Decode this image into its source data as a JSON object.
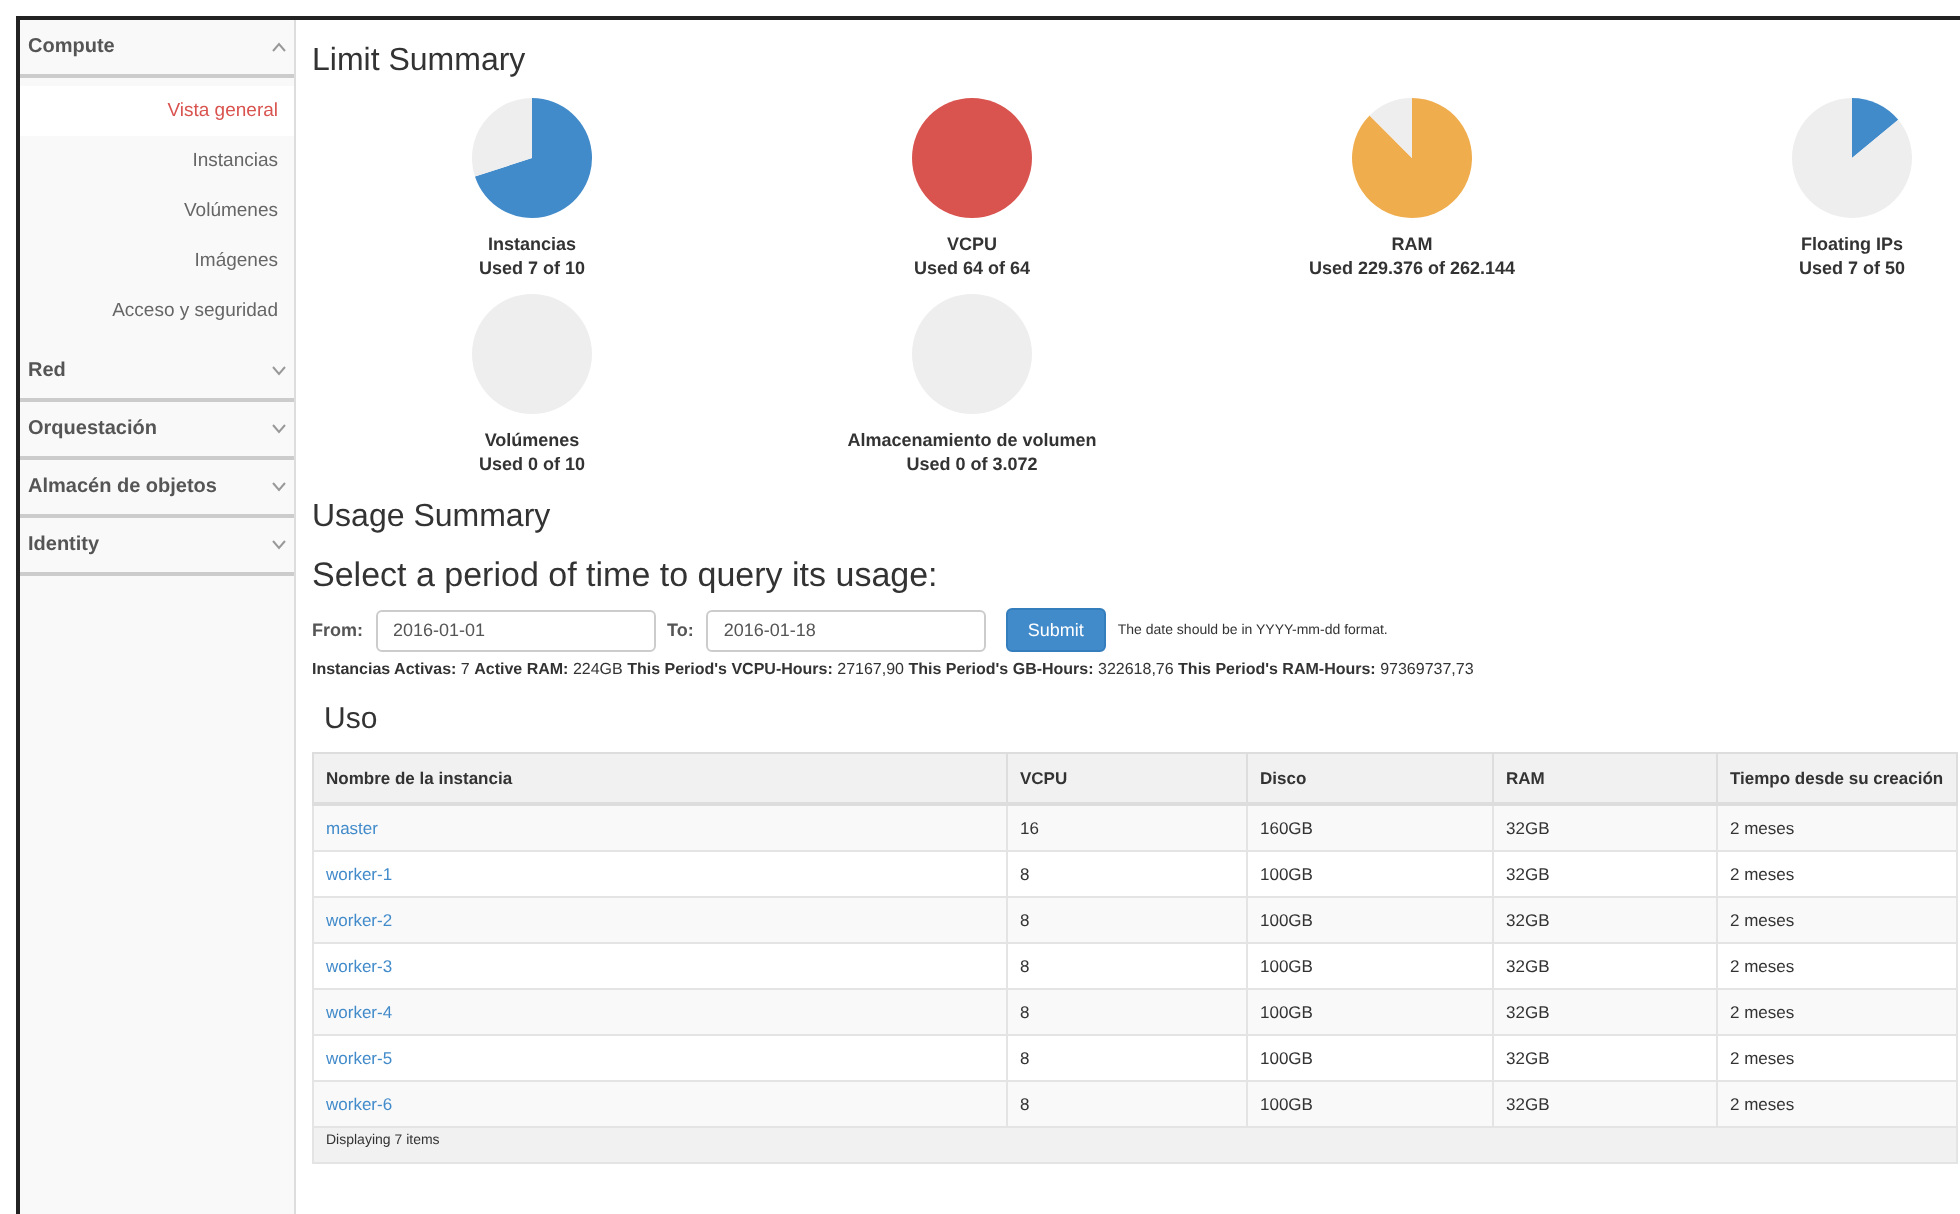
{
  "sidebar": {
    "sections": [
      {
        "label": "Compute",
        "expanded": true,
        "items": [
          {
            "label": "Vista general",
            "selected": true
          },
          {
            "label": "Instancias",
            "selected": false
          },
          {
            "label": "Volúmenes",
            "selected": false
          },
          {
            "label": "Imágenes",
            "selected": false
          },
          {
            "label": "Acceso y seguridad",
            "selected": false
          }
        ]
      },
      {
        "label": "Red",
        "expanded": false
      },
      {
        "label": "Orquestación",
        "expanded": false
      },
      {
        "label": "Almacén de objetos",
        "expanded": false
      },
      {
        "label": "Identity",
        "expanded": false
      }
    ]
  },
  "limit_summary": {
    "title": "Limit Summary",
    "meters": [
      {
        "name": "Instancias",
        "reading": "Used 7 of 10",
        "chart_data": {
          "type": "pie",
          "values": [
            70,
            30
          ]
        }
      },
      {
        "name": "VCPU",
        "reading": "Used 64 of 64",
        "chart_data": {
          "type": "pie",
          "values": [
            100,
            0
          ]
        }
      },
      {
        "name": "RAM",
        "reading": "Used 229.376 of 262.144",
        "chart_data": {
          "type": "pie",
          "values": [
            87.5,
            12.5
          ]
        }
      },
      {
        "name": "Floating IPs",
        "reading": "Used 7 of 50",
        "chart_data": {
          "type": "pie",
          "values": [
            14,
            86
          ]
        }
      },
      {
        "name": "Volúmenes",
        "reading": "Used 0 of 10",
        "chart_data": {
          "type": "pie",
          "values": [
            0,
            100
          ]
        }
      },
      {
        "name": "Almacenamiento de volumen",
        "reading": "Used 0 of 3.072",
        "chart_data": {
          "type": "pie",
          "values": [
            0,
            100
          ]
        }
      }
    ]
  },
  "usage_summary": {
    "title": "Usage Summary",
    "subtitle": "Select a period of time to query its usage:",
    "from": {
      "label": "From:",
      "value": "2016-01-01"
    },
    "to": {
      "label": "To:",
      "value": "2016-01-18"
    },
    "submit": "Submit",
    "hint": "The date should be in YYYY-mm-dd format.",
    "stats": "**Instancias Activas:** 7 **Active RAM:** 224GB **This Period's VCPU-Hours:** 27167,90 **This Period's GB-Hours:** 322618,76 **This Period's RAM-Hours:** 97369737,73"
  },
  "table": {
    "title": "Uso",
    "columns": [
      "Nombre de la instancia",
      "VCPU",
      "Disco",
      "RAM",
      "Tiempo desde su creación"
    ],
    "rows": [
      [
        "master",
        "16",
        "160GB",
        "32GB",
        "2 meses"
      ],
      [
        "worker-1",
        "8",
        "100GB",
        "32GB",
        "2 meses"
      ],
      [
        "worker-2",
        "8",
        "100GB",
        "32GB",
        "2 meses"
      ],
      [
        "worker-3",
        "8",
        "100GB",
        "32GB",
        "2 meses"
      ],
      [
        "worker-4",
        "8",
        "100GB",
        "32GB",
        "2 meses"
      ],
      [
        "worker-5",
        "8",
        "100GB",
        "32GB",
        "2 meses"
      ],
      [
        "worker-6",
        "8",
        "100GB",
        "32GB",
        "2 meses"
      ]
    ],
    "footer": "Displaying 7 items"
  }
}
